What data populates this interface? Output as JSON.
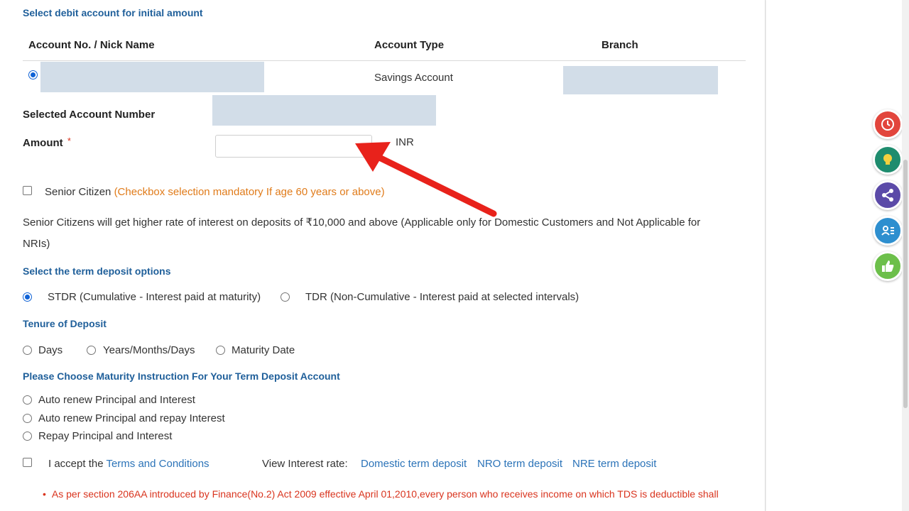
{
  "form": {
    "debit_section_title": "Select debit account for initial amount",
    "table": {
      "headers": [
        "Account No. / Nick Name",
        "Account Type",
        "Branch"
      ],
      "row": {
        "account_type": "Savings Account"
      }
    },
    "selected_account_label": "Selected Account Number",
    "amount_label": "Amount",
    "amount_required_mark": "*",
    "amount_value": "",
    "currency": "INR",
    "senior_citizen_label": "Senior Citizen",
    "senior_citizen_note": "(Checkbox selection mandatory If age 60 years or above)",
    "senior_info_line1": "Senior Citizens will get higher rate of interest on deposits of ₹10,000 and above (Applicable only for Domestic Customers and Not Applicable for",
    "senior_info_line2": "NRIs)",
    "term_options_title": "Select the term deposit options",
    "term_options": [
      "STDR (Cumulative - Interest paid at maturity)",
      "TDR (Non-Cumulative - Interest paid at selected intervals)"
    ],
    "tenure_title": "Tenure of Deposit",
    "tenure_options": [
      "Days",
      "Years/Months/Days",
      "Maturity Date"
    ],
    "maturity_title": "Please Choose Maturity Instruction For Your Term Deposit Account",
    "maturity_options": [
      "Auto renew Principal and Interest",
      "Auto renew Principal and repay Interest",
      "Repay Principal and Interest"
    ],
    "accept_prefix": "I accept the",
    "terms_link": "Terms and Conditions",
    "view_rate_label": "View Interest rate:",
    "rate_links": [
      "Domestic term deposit",
      "NRO term deposit",
      "NRE term deposit"
    ],
    "footnote": "As per section 206AA introduced by Finance(No.2) Act 2009 effective April 01,2010,every person who receives income on which TDS is deductible shall"
  },
  "colors": {
    "section_title": "#1f5f9a",
    "link": "#2b73b8",
    "annotation_arrow": "#e8221b"
  },
  "side_buttons": [
    {
      "icon": "history-clock-icon",
      "color": "#e2453c"
    },
    {
      "icon": "lightbulb-icon",
      "color": "#1e8c6e"
    },
    {
      "icon": "share-icon",
      "color": "#5b4aa8"
    },
    {
      "icon": "profile-list-icon",
      "color": "#2e8fcf"
    },
    {
      "icon": "thumbs-up-icon",
      "color": "#6cbf4a"
    }
  ]
}
